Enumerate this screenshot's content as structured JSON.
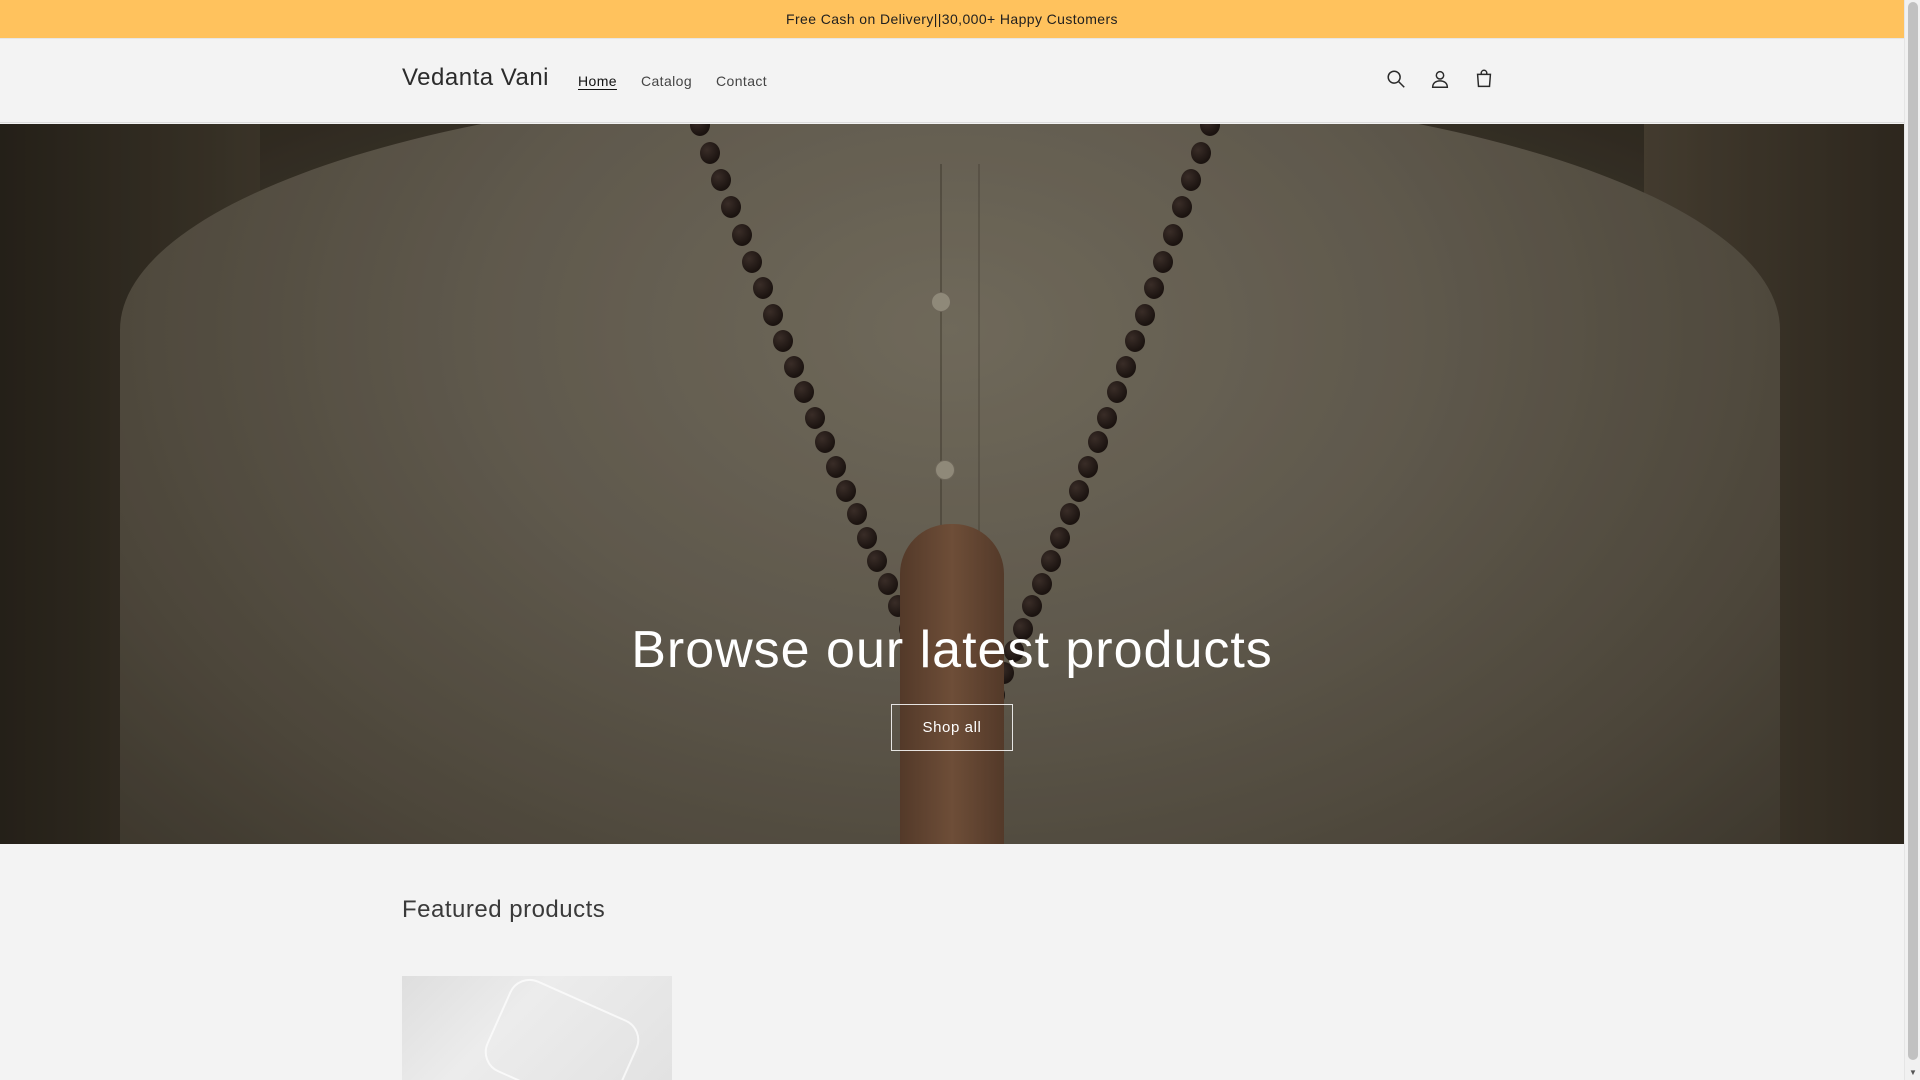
{
  "announcement": {
    "text": "Free Cash on Delivery||30,000+ Happy Customers"
  },
  "header": {
    "logo": "Vedanta Vani",
    "nav": [
      {
        "label": "Home",
        "active": true
      },
      {
        "label": "Catalog",
        "active": false
      },
      {
        "label": "Contact",
        "active": false
      }
    ],
    "icons": [
      "search-icon",
      "account-icon",
      "cart-icon"
    ]
  },
  "hero": {
    "title": "Browse our latest products",
    "button_label": "Shop all"
  },
  "featured": {
    "title": "Featured products"
  },
  "colors": {
    "announcement_bg": "#ffc25d",
    "page_bg": "#f3f3f3"
  }
}
